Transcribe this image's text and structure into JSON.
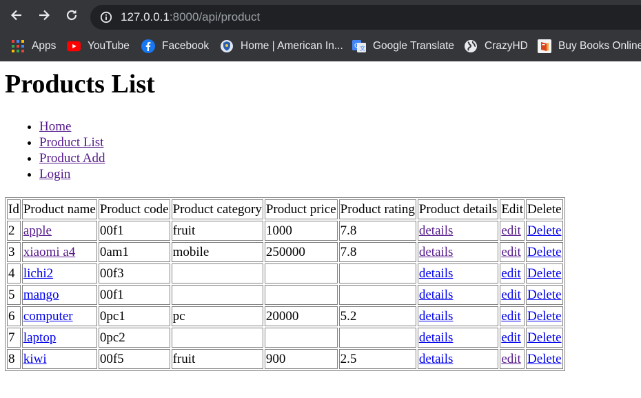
{
  "browser": {
    "url_host": "127.0.0.1",
    "url_rest": ":8000/api/product",
    "bookmarks": [
      {
        "label": "Apps",
        "icon": "apps-grid-icon"
      },
      {
        "label": "YouTube",
        "icon": "youtube-icon"
      },
      {
        "label": "Facebook",
        "icon": "facebook-icon"
      },
      {
        "label": "Home | American In...",
        "icon": "shield-icon"
      },
      {
        "label": "Google Translate",
        "icon": "google-translate-icon"
      },
      {
        "label": "CrazyHD",
        "icon": "globe-icon"
      },
      {
        "label": "Buy Books Online",
        "icon": "book-icon"
      }
    ]
  },
  "page": {
    "title": "Products List",
    "nav": [
      "Home",
      "Product List",
      "Product Add",
      "Login"
    ]
  },
  "table": {
    "headers": [
      "Id",
      "Product name",
      "Product code",
      "Product category",
      "Product price",
      "Product rating",
      "Product details",
      "Edit",
      "Delete"
    ],
    "rows": [
      {
        "id": "2",
        "name": "apple",
        "code": "00f1",
        "category": "fruit",
        "price": "1000",
        "rating": "7.8",
        "details": "details",
        "edit": "edit",
        "delete": "Delete"
      },
      {
        "id": "3",
        "name": "xiaomi a4",
        "code": "0am1",
        "category": "mobile",
        "price": "250000",
        "rating": "7.8",
        "details": "details",
        "edit": "edit",
        "delete": "Delete"
      },
      {
        "id": "4",
        "name": "lichi2",
        "code": "00f3",
        "category": "",
        "price": "",
        "rating": "",
        "details": "details",
        "edit": "edit",
        "delete": "Delete"
      },
      {
        "id": "5",
        "name": "mango",
        "code": "00f1",
        "category": "",
        "price": "",
        "rating": "",
        "details": "details",
        "edit": "edit",
        "delete": "Delete"
      },
      {
        "id": "6",
        "name": "computer",
        "code": "0pc1",
        "category": "pc",
        "price": "20000",
        "rating": "5.2",
        "details": "details",
        "edit": "edit",
        "delete": "Delete"
      },
      {
        "id": "7",
        "name": "laptop",
        "code": "0pc2",
        "category": "",
        "price": "",
        "rating": "",
        "details": "details",
        "edit": "edit",
        "delete": "Delete"
      },
      {
        "id": "8",
        "name": "kiwi",
        "code": "00f5",
        "category": "fruit",
        "price": "900",
        "rating": "2.5",
        "details": "details",
        "edit": "edit",
        "delete": "Delete"
      }
    ]
  }
}
